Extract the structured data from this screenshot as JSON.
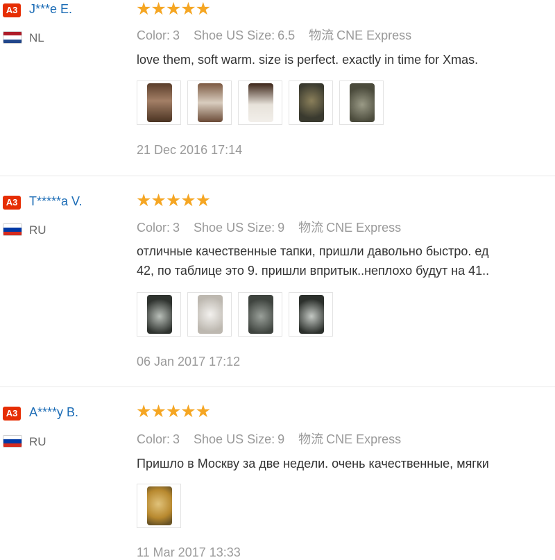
{
  "reviews": [
    {
      "badge": "A3",
      "user": "J***e E.",
      "country": "NL",
      "stars": "★★★★★",
      "color_label": "Color:",
      "color_value": "3",
      "size_label": "Shoe US Size:",
      "size_value": "6.5",
      "shipping_label": "物流",
      "shipping_value": "CNE Express",
      "feedback_lines": [
        "love them, soft warm. size is perfect. exactly in time for Xmas."
      ],
      "photos": 5,
      "date": "21 Dec 2016 17:14"
    },
    {
      "badge": "A3",
      "user": "T*****a V.",
      "country": "RU",
      "stars": "★★★★★",
      "color_label": "Color:",
      "color_value": "3",
      "size_label": "Shoe US Size:",
      "size_value": "9",
      "shipping_label": "物流",
      "shipping_value": "CNE Express",
      "feedback_lines": [
        "отличные качественные тапки, пришли давольно быстро. ед",
        "42, по таблице это 9. пришли впритык..неплохо будут на 41.."
      ],
      "photos": 4,
      "date": "06 Jan 2017 17:12"
    },
    {
      "badge": "A3",
      "user": "A****y B.",
      "country": "RU",
      "stars": "★★★★★",
      "color_label": "Color:",
      "color_value": "3",
      "size_label": "Shoe US Size:",
      "size_value": "9",
      "shipping_label": "物流",
      "shipping_value": "CNE Express",
      "feedback_lines": [
        "Пришло в Москву за две недели. очень качественные, мягки"
      ],
      "photos": 1,
      "date": "11 Mar 2017 13:33"
    }
  ],
  "colors": {
    "badge": "#e62e04",
    "username": "#1a6bb5",
    "star": "#f5a623",
    "muted": "#999999"
  }
}
